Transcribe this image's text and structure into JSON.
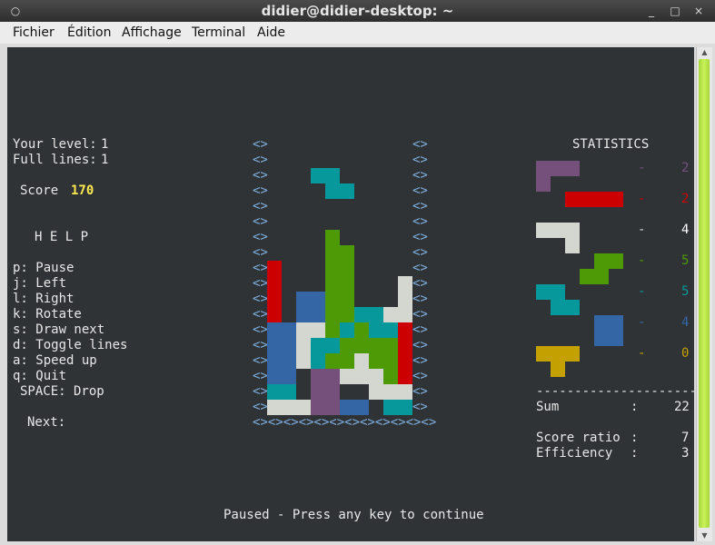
{
  "window": {
    "title": "didier@didier-desktop: ~",
    "buttons": {
      "menu": "○",
      "minimize": "_",
      "maximize": "□",
      "close": "×"
    }
  },
  "menubar": [
    {
      "label": "Fichier"
    },
    {
      "label": "Édition"
    },
    {
      "label": "Affichage"
    },
    {
      "label": "Terminal"
    },
    {
      "label": "Aide"
    }
  ],
  "left_panel": {
    "level_label": "Your level:",
    "level_value": "1",
    "lines_label": "Full lines:",
    "lines_value": "1",
    "score_label": "Score",
    "score_value": "170",
    "help_title": "H E L P",
    "help_lines": [
      "p: Pause",
      "j: Left",
      "l: Right",
      "k: Rotate",
      "s: Draw next",
      "d: Toggle lines",
      "a: Speed up",
      "q: Quit",
      "SPACE: Drop"
    ],
    "next_label": "Next:"
  },
  "board": {
    "wall_glyph": "<>",
    "floor": "<><><><><><><><><><><><>",
    "colors": {
      "R": "#cc0000",
      "B": "#3465a4",
      "W": "#d3d7cf",
      "T": "#06989a",
      "G": "#4e9a06",
      "P": "#75507b",
      "Y": "#c4a000"
    },
    "grid": [
      "..........",
      "..........",
      "...TT.....",
      "....TT....",
      "..........",
      "..........",
      "....G.....",
      "....GG....",
      "R...GG....",
      "R...GG...W",
      "R.BBGG...W",
      "R.BBGGTTWW",
      "BBWWGTGTTR",
      "BBWTTGGGGR",
      "BBWTGGWGGR",
      "BB.PPWWWGR",
      "TT.PP..WWW",
      "WWWPPBB.TT"
    ]
  },
  "statistics": {
    "title": "STATISTICS",
    "rows": [
      {
        "color": "#75507b",
        "count": "2"
      },
      {
        "color": "#cc0000",
        "count": "2"
      },
      {
        "color": "#d3d7cf",
        "count": "4"
      },
      {
        "color": "#4e9a06",
        "count": "5"
      },
      {
        "color": "#06989a",
        "count": "5"
      },
      {
        "color": "#3465a4",
        "count": "4"
      },
      {
        "color": "#c4a000",
        "count": "0"
      }
    ],
    "dash": "-",
    "separator": "----------------------",
    "sum_label": "Sum",
    "sum_value": "22",
    "ratio_label": "Score ratio",
    "ratio_value": "7",
    "efficiency_label": "Efficiency",
    "efficiency_value": "3",
    "colon": ":"
  },
  "status_message": "Paused - Press any key to continue"
}
